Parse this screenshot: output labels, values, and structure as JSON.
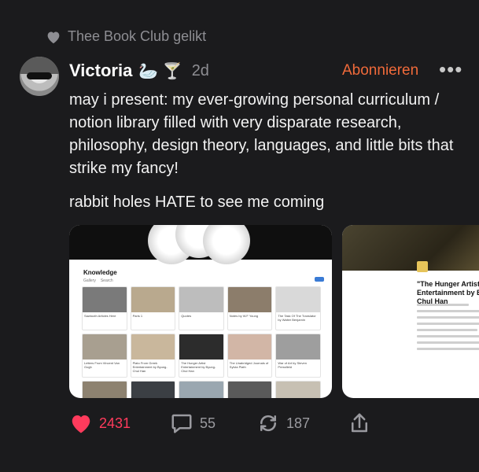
{
  "liked_by": "Thee Book Club gelikt",
  "post": {
    "username": "Victoria",
    "emojis": "🦢 🍸",
    "time": "2d",
    "follow_label": "Abonnieren",
    "more_label": "•••",
    "paragraphs": [
      "may i present: my ever-growing personal curriculum / notion library filled with very disparate research, philosophy, design theory, languages, and little bits that strike my fancy!",
      "rabbit holes HATE to see me coming"
    ]
  },
  "media": {
    "card1": {
      "title": "Knowledge",
      "tabs": [
        "Gallery",
        "Search"
      ],
      "tiles": [
        {
          "caption": "Sawtooth Articles Here",
          "color": "#7a7a7a"
        },
        {
          "caption": "Paris 1",
          "color": "#b9a98e"
        },
        {
          "caption": "Quotes",
          "color": "#bdbdbd"
        },
        {
          "caption": "Notes by W.F Young",
          "color": "#8c7d6b"
        },
        {
          "caption": "The Task Of The Translator by Walter Benjamin",
          "color": "#d9d9d9"
        },
        {
          "caption": "Letters From Vincent Van Gogh",
          "color": "#a89f90"
        },
        {
          "caption": "Plato From Greek Entertainment by Byung-Chul Han",
          "color": "#c9b79c"
        },
        {
          "caption": "The Hunger Artist Entertainment by Byung-Chul Han",
          "color": "#2c2c2c"
        },
        {
          "caption": "The Unabridged Journals of Sylvia Plath",
          "color": "#d2b6a6"
        },
        {
          "caption": "War of Art by Steven Pressfield",
          "color": "#9e9e9e"
        },
        {
          "caption": "",
          "color": "#8d8270"
        },
        {
          "caption": "",
          "color": "#3b3f44"
        },
        {
          "caption": "",
          "color": "#9aa7b0"
        },
        {
          "caption": "",
          "color": "#5a5a5a"
        },
        {
          "caption": "",
          "color": "#c7c0b3"
        }
      ]
    },
    "card2": {
      "title": "\"The Hunger Artist\" from Entertainment by Byung-Chul Han"
    }
  },
  "actions": {
    "likes": "2431",
    "comments": "55",
    "reposts": "187"
  },
  "colors": {
    "background": "#1b1b1d",
    "accent": "#f06a3a",
    "like": "#ff3b5c",
    "muted": "#8e8e93"
  }
}
